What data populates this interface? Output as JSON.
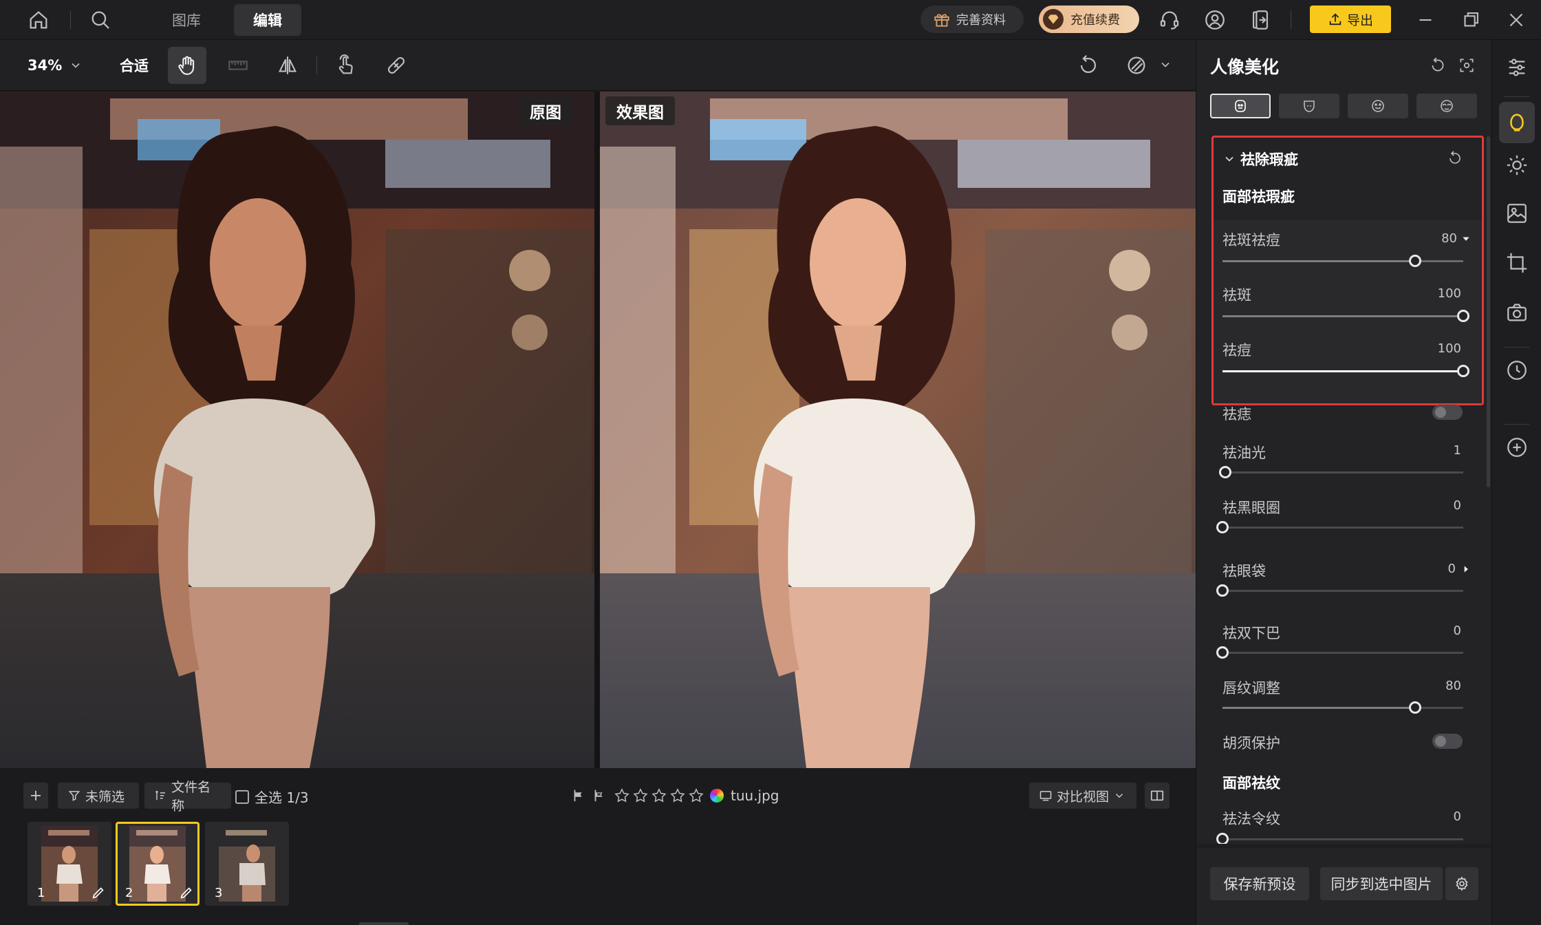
{
  "topnav": {
    "tab_library": "图库",
    "tab_edit": "编辑",
    "complete_profile": "完善资料",
    "recharge": "充值续费",
    "export": "导出"
  },
  "toolbar": {
    "zoom": "34%",
    "fit": "合适"
  },
  "viewer": {
    "original_label": "原图",
    "result_label": "效果图"
  },
  "filmstrip": {
    "filter_label": "未筛选",
    "sort_label": "文件名称",
    "select_all": "全选 1/3",
    "filename": "tuu.jpg",
    "compare_view": "对比视图",
    "thumbnails": [
      {
        "num": "1"
      },
      {
        "num": "2"
      },
      {
        "num": "3"
      }
    ]
  },
  "panel": {
    "title": "人像美化",
    "section_title": "祛除瑕疵",
    "subsection_face": "面部祛瑕疵",
    "sliders_highlight": [
      {
        "label": "祛斑祛痘",
        "value": "80",
        "level": 80
      },
      {
        "label": "祛斑",
        "value": "100",
        "level": 100
      },
      {
        "label": "祛痘",
        "value": "100",
        "level": 100
      }
    ],
    "mole_label": "祛痣",
    "sliders": [
      {
        "label": "祛油光",
        "value": "1",
        "level": 1
      },
      {
        "label": "祛黑眼圈",
        "value": "0",
        "level": 0
      },
      {
        "label": "祛眼袋",
        "value": "0",
        "level": 0
      },
      {
        "label": "祛双下巴",
        "value": "0",
        "level": 0
      },
      {
        "label": "唇纹调整",
        "value": "80",
        "level": 80
      }
    ],
    "beard_label": "胡须保护",
    "subsection_wrinkle": "面部祛纹",
    "nasolabial_label": "祛法令纹",
    "nasolabial_value": "0",
    "nasolabial_level": 0,
    "save_preset": "保存新预设",
    "sync_selected": "同步到选中图片"
  },
  "colors": {
    "accent_yellow": "#f8c91c",
    "highlight_red": "#e03a3a",
    "panel_bg": "#232326"
  }
}
